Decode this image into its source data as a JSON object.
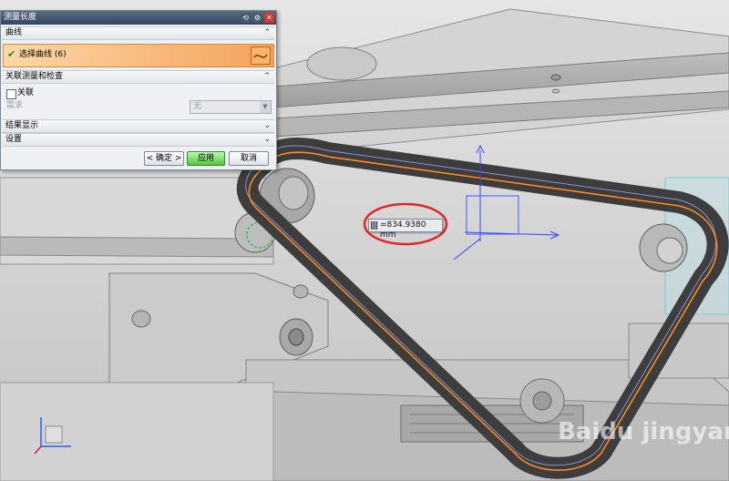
{
  "dialog": {
    "title": "测量长度",
    "sections": {
      "curve": "曲线",
      "associative": "关联测量和检查",
      "results": "结果显示",
      "settings": "设置"
    },
    "select_curve_label": "选择曲线 (6)",
    "associative_checkbox_label": "关联",
    "requirement_label": "需求",
    "requirement_value": "无",
    "buttons": {
      "ok": "< 确定 >",
      "apply": "应用",
      "cancel": "取消"
    }
  },
  "measurement": {
    "value": "=834.9380 mm"
  },
  "watermark": "Baidu jingyan",
  "colors": {
    "belt_highlight": "#ff8a1e",
    "measure_circle": "#e0282a",
    "datum_blue": "#3346ff"
  }
}
